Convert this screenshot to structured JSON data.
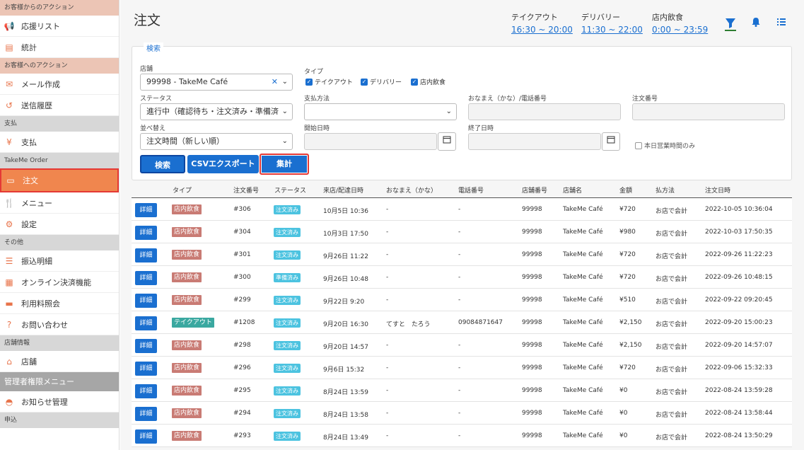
{
  "sidebar": {
    "sections": [
      {
        "title": "お客様からのアクション",
        "style": "peach",
        "items": [
          {
            "label": "応援リスト",
            "icon": "megaphone-icon"
          },
          {
            "label": "統計",
            "icon": "chart-icon"
          }
        ]
      },
      {
        "title": "お客様へのアクション",
        "style": "peach",
        "items": [
          {
            "label": "メール作成",
            "icon": "mail-icon"
          },
          {
            "label": "送信履歴",
            "icon": "history-icon"
          }
        ]
      },
      {
        "title": "支払",
        "style": "gray",
        "items": [
          {
            "label": "支払",
            "icon": "yen-icon"
          }
        ]
      },
      {
        "title": "TakeMe Order",
        "style": "gray",
        "items": [
          {
            "label": "注文",
            "icon": "order-icon",
            "active": true
          },
          {
            "label": "メニュー",
            "icon": "utensils-icon"
          },
          {
            "label": "設定",
            "icon": "gear-icon"
          }
        ]
      },
      {
        "title": "その他",
        "style": "gray",
        "items": [
          {
            "label": "振込明細",
            "icon": "list-icon"
          },
          {
            "label": "オンライン決済機能",
            "icon": "qr-icon"
          },
          {
            "label": "利用料照会",
            "icon": "card-icon"
          },
          {
            "label": "お問い合わせ",
            "icon": "help-icon"
          }
        ]
      },
      {
        "title": "店舗情報",
        "style": "gray",
        "items": [
          {
            "label": "店舗",
            "icon": "store-icon"
          }
        ]
      },
      {
        "title": "管理者権限メニュー",
        "style": "dark",
        "items": [
          {
            "label": "お知らせ管理",
            "icon": "bell-desk-icon"
          }
        ]
      },
      {
        "title": "申込",
        "style": "gray",
        "items": []
      }
    ]
  },
  "header": {
    "title": "注文",
    "hours": [
      {
        "label": "テイクアウト",
        "value": "16:30 ~ 20:00"
      },
      {
        "label": "デリバリー",
        "value": "11:30 ~ 22:00"
      },
      {
        "label": "店内飲食",
        "value": "0:00 ~ 23:59"
      }
    ]
  },
  "search": {
    "legend": "検索",
    "store_label": "店舗",
    "store_value": "99998 - TakeMe Café",
    "type_label": "タイプ",
    "type_options": [
      {
        "label": "テイクアウト",
        "checked": true
      },
      {
        "label": "デリバリー",
        "checked": true
      },
      {
        "label": "店内飲食",
        "checked": true
      }
    ],
    "status_label": "ステータス",
    "status_value": "進行中（確認待ち・注文済み・準備済",
    "payment_label": "支払方法",
    "payment_value": "",
    "name_label": "おなまえ（かな）/電話番号",
    "order_no_label": "注文番号",
    "sort_label": "並べ替え",
    "sort_value": "注文時間（新しい順）",
    "start_label": "開始日時",
    "end_label": "終了日時",
    "today_only_label": "本日営業時間のみ",
    "today_only_checked": false,
    "btn_search": "検索",
    "btn_csv": "CSVエクスポート",
    "btn_aggregate": "集計"
  },
  "table": {
    "columns": [
      "タイプ",
      "注文番号",
      "ステータス",
      "来店/配達日時",
      "おなまえ（かな）",
      "電話番号",
      "店舗番号",
      "店舗名",
      "金額",
      "払方法",
      "注文日時"
    ],
    "detail_label": "詳細",
    "rows": [
      {
        "type": "店内飲食",
        "type_kind": "dine",
        "no": "#306",
        "status": "注文済み",
        "visit": "10月5日 10:36",
        "name": "-",
        "phone": "-",
        "store_no": "99998",
        "store": "TakeMe Café",
        "amount": "¥720",
        "pay": "お店で会計",
        "ordered": "2022-10-05 10:36:04"
      },
      {
        "type": "店内飲食",
        "type_kind": "dine",
        "no": "#304",
        "status": "注文済み",
        "visit": "10月3日 17:50",
        "name": "-",
        "phone": "-",
        "store_no": "99998",
        "store": "TakeMe Café",
        "amount": "¥980",
        "pay": "お店で会計",
        "ordered": "2022-10-03 17:50:35"
      },
      {
        "type": "店内飲食",
        "type_kind": "dine",
        "no": "#301",
        "status": "注文済み",
        "visit": "9月26日 11:22",
        "name": "-",
        "phone": "-",
        "store_no": "99998",
        "store": "TakeMe Café",
        "amount": "¥720",
        "pay": "お店で会計",
        "ordered": "2022-09-26 11:22:23"
      },
      {
        "type": "店内飲食",
        "type_kind": "dine",
        "no": "#300",
        "status": "準備済み",
        "visit": "9月26日 10:48",
        "name": "-",
        "phone": "-",
        "store_no": "99998",
        "store": "TakeMe Café",
        "amount": "¥720",
        "pay": "お店で会計",
        "ordered": "2022-09-26 10:48:15"
      },
      {
        "type": "店内飲食",
        "type_kind": "dine",
        "no": "#299",
        "status": "注文済み",
        "visit": "9月22日 9:20",
        "name": "-",
        "phone": "-",
        "store_no": "99998",
        "store": "TakeMe Café",
        "amount": "¥510",
        "pay": "お店で会計",
        "ordered": "2022-09-22 09:20:45"
      },
      {
        "type": "テイクアウト",
        "type_kind": "take",
        "no": "#1208",
        "status": "注文済み",
        "visit": "9月20日 16:30",
        "name": "てすと　たろう",
        "phone": "09084871647",
        "store_no": "99998",
        "store": "TakeMe Café",
        "amount": "¥2,150",
        "pay": "お店で会計",
        "ordered": "2022-09-20 15:00:23"
      },
      {
        "type": "店内飲食",
        "type_kind": "dine",
        "no": "#298",
        "status": "注文済み",
        "visit": "9月20日 14:57",
        "name": "-",
        "phone": "-",
        "store_no": "99998",
        "store": "TakeMe Café",
        "amount": "¥2,150",
        "pay": "お店で会計",
        "ordered": "2022-09-20 14:57:07"
      },
      {
        "type": "店内飲食",
        "type_kind": "dine",
        "no": "#296",
        "status": "注文済み",
        "visit": "9月6日 15:32",
        "name": "-",
        "phone": "-",
        "store_no": "99998",
        "store": "TakeMe Café",
        "amount": "¥720",
        "pay": "お店で会計",
        "ordered": "2022-09-06 15:32:33"
      },
      {
        "type": "店内飲食",
        "type_kind": "dine",
        "no": "#295",
        "status": "注文済み",
        "visit": "8月24日 13:59",
        "name": "-",
        "phone": "-",
        "store_no": "99998",
        "store": "TakeMe Café",
        "amount": "¥0",
        "pay": "お店で会計",
        "ordered": "2022-08-24 13:59:28"
      },
      {
        "type": "店内飲食",
        "type_kind": "dine",
        "no": "#294",
        "status": "注文済み",
        "visit": "8月24日 13:58",
        "name": "-",
        "phone": "-",
        "store_no": "99998",
        "store": "TakeMe Café",
        "amount": "¥0",
        "pay": "お店で会計",
        "ordered": "2022-08-24 13:58:44"
      },
      {
        "type": "店内飲食",
        "type_kind": "dine",
        "no": "#293",
        "status": "注文済み",
        "visit": "8月24日 13:49",
        "name": "-",
        "phone": "-",
        "store_no": "99998",
        "store": "TakeMe Café",
        "amount": "¥0",
        "pay": "お店で会計",
        "ordered": "2022-08-24 13:50:29"
      }
    ]
  },
  "colors": {
    "accent": "#1a6fd0",
    "sidebar_active": "#f0864e",
    "highlight": "#e53935"
  }
}
